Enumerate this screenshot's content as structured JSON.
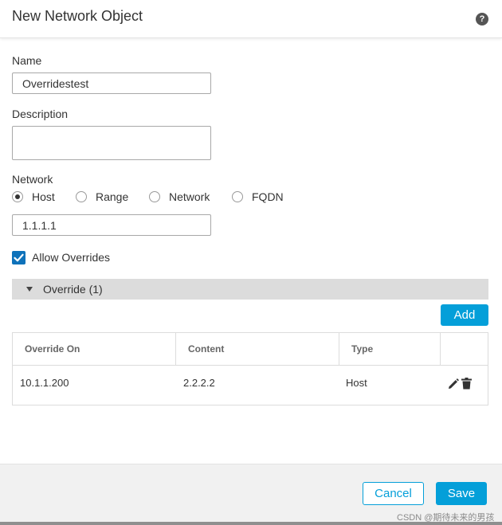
{
  "dialog": {
    "title": "New Network Object",
    "help_icon": "?"
  },
  "form": {
    "name_label": "Name",
    "name_value": "Overridestest",
    "description_label": "Description",
    "description_value": "",
    "network_label": "Network",
    "network_types": [
      {
        "label": "Host",
        "selected": true
      },
      {
        "label": "Range",
        "selected": false
      },
      {
        "label": "Network",
        "selected": false
      },
      {
        "label": "FQDN",
        "selected": false
      }
    ],
    "network_value": "1.1.1.1",
    "allow_overrides_label": "Allow Overrides",
    "allow_overrides_checked": true
  },
  "override_section": {
    "title": "Override (1)",
    "expanded": true,
    "add_label": "Add",
    "columns": [
      "Override On",
      "Content",
      "Type",
      ""
    ],
    "rows": [
      {
        "override_on": "10.1.1.200",
        "content": "2.2.2.2",
        "type": "Host",
        "actions": [
          "pencil-icon",
          "trash-icon"
        ]
      }
    ]
  },
  "footer": {
    "cancel_label": "Cancel",
    "save_label": "Save"
  },
  "watermark": "CSDN @期待未来的男孩",
  "colors": {
    "accent": "#049fd9",
    "checkbox": "#0e72ba",
    "section_bar": "#dcdcdc",
    "footer_bg": "#f1f1f1"
  }
}
